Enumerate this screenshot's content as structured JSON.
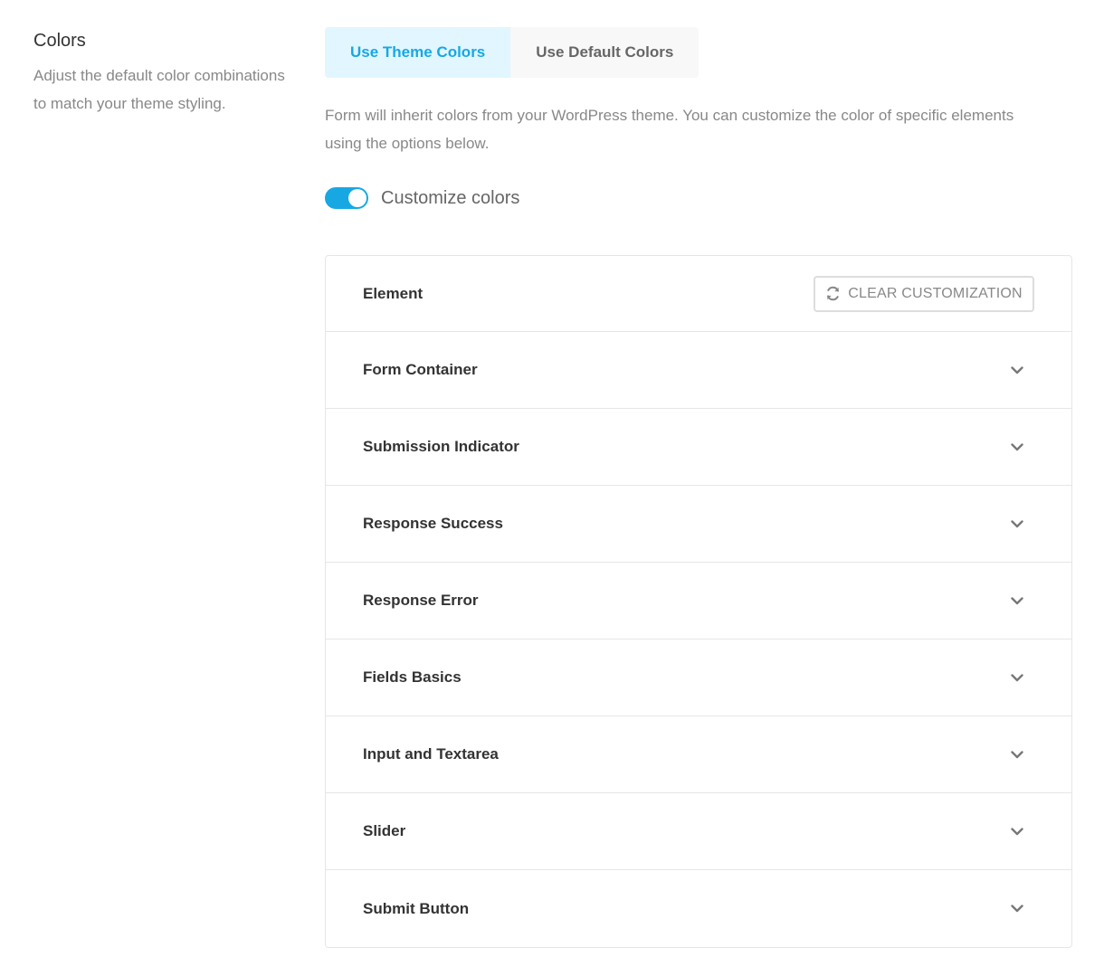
{
  "section": {
    "title": "Colors",
    "description": "Adjust the default color combinations to match your theme styling."
  },
  "tabs": [
    {
      "label": "Use Theme Colors",
      "active": true
    },
    {
      "label": "Use Default Colors",
      "active": false
    }
  ],
  "info_text": "Form will inherit colors from your WordPress theme. You can customize the color of specific elements using the options below.",
  "customize_toggle": {
    "label": "Customize colors",
    "on": true
  },
  "table": {
    "header_label": "Element",
    "clear_button": "CLEAR CUSTOMIZATION",
    "clear_icon": "refresh-icon",
    "rows": [
      {
        "label": "Form Container",
        "icon": "chevron-down-icon"
      },
      {
        "label": "Submission Indicator",
        "icon": "chevron-down-icon"
      },
      {
        "label": "Response Success",
        "icon": "chevron-down-icon"
      },
      {
        "label": "Response Error",
        "icon": "chevron-down-icon"
      },
      {
        "label": "Fields Basics",
        "icon": "chevron-down-icon"
      },
      {
        "label": "Input and Textarea",
        "icon": "chevron-down-icon"
      },
      {
        "label": "Slider",
        "icon": "chevron-down-icon"
      },
      {
        "label": "Submit Button",
        "icon": "chevron-down-icon"
      }
    ]
  },
  "colors": {
    "accent": "#17a8e3",
    "accent_bg": "#e1f6ff",
    "muted_text": "#888888",
    "border": "#e6e6e6"
  }
}
